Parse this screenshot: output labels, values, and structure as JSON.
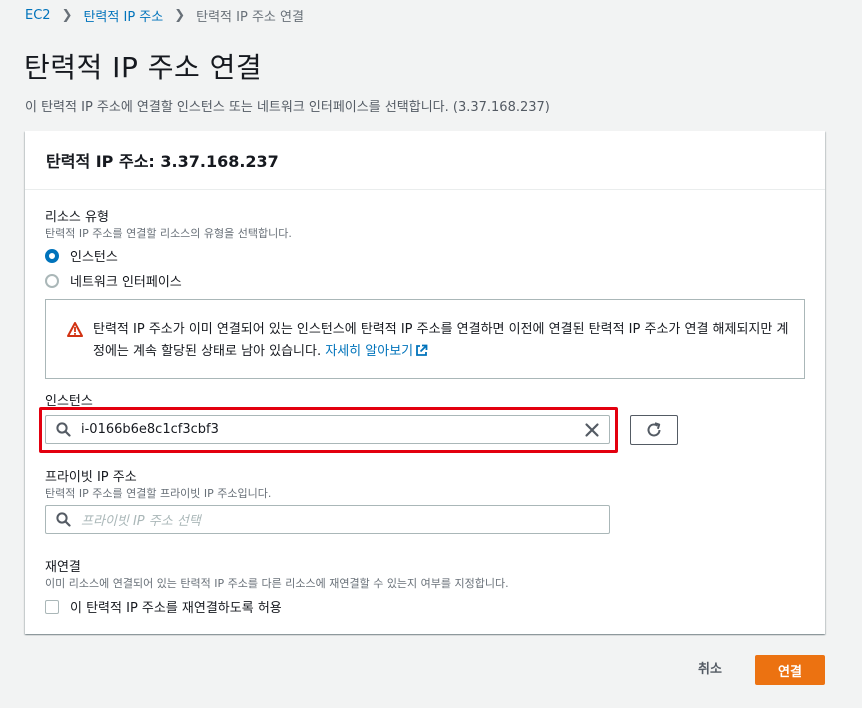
{
  "breadcrumb": {
    "items": [
      "EC2",
      "탄력적 IP 주소",
      "탄력적 IP 주소 연결"
    ]
  },
  "page": {
    "title": "탄력적 IP 주소 연결",
    "description": "이 탄력적 IP 주소에 연결할 인스턴스 또는 네트워크 인터페이스를 선택합니다. (3.37.168.237)"
  },
  "panel": {
    "header": "탄력적 IP 주소: 3.37.168.237",
    "resource_type": {
      "label": "리소스 유형",
      "description": "탄력적 IP 주소를 연결할 리소스의 유형을 선택합니다.",
      "options": [
        {
          "label": "인스턴스",
          "selected": true
        },
        {
          "label": "네트워크 인터페이스",
          "selected": false
        }
      ]
    },
    "alert": {
      "text": "탄력적 IP 주소가 이미 연결되어 있는 인스턴스에 탄력적 IP 주소를 연결하면 이전에 연결된 탄력적 IP 주소가 연결 해제되지만 계정에는 계속 할당된 상태로 남아 있습니다.",
      "link": "자세히 알아보기",
      "icon": "warning-icon",
      "color": "#d13212"
    },
    "instance": {
      "label": "인스턴스",
      "value": "i-0166b6e8c1cf3cbf3"
    },
    "private_ip": {
      "label": "프라이빗 IP 주소",
      "description": "탄력적 IP 주소를 연결할 프라이빗 IP 주소입니다.",
      "placeholder": "프라이빗 IP 주소 선택"
    },
    "reassociation": {
      "label": "재연결",
      "description": "이미 리소스에 연결되어 있는 탄력적 IP 주소를 다른 리소스에 재연결할 수 있는지 여부를 지정합니다.",
      "checkbox_label": "이 탄력적 IP 주소를 재연결하도록 허용",
      "checked": false
    }
  },
  "actions": {
    "cancel": "취소",
    "connect": "연결"
  },
  "colors": {
    "primary": "#ec7211",
    "link": "#0073bb",
    "highlight": "#e3000f"
  }
}
